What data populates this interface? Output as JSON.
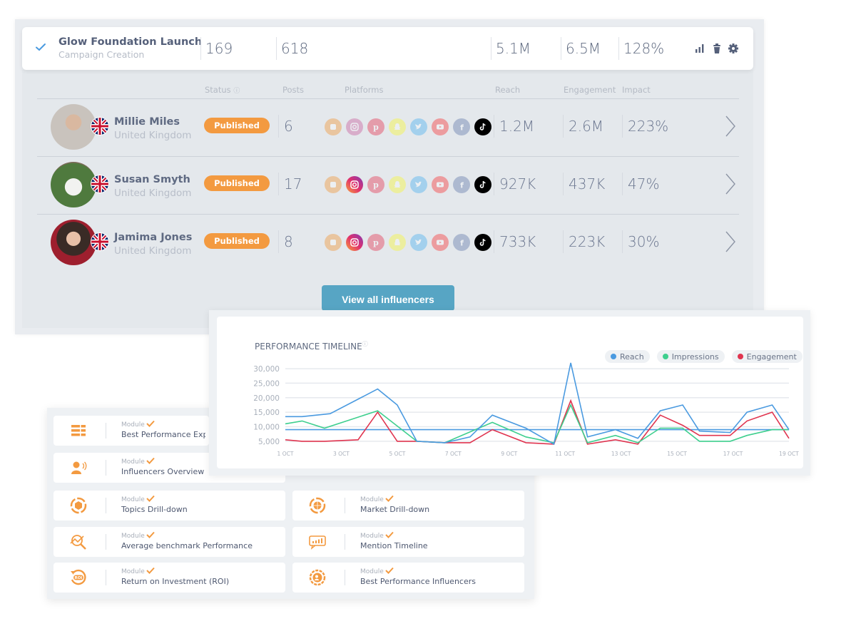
{
  "campaign": {
    "title": "Glow Foundation Launch",
    "subtitle": "Campaign Creation",
    "stats": {
      "influencers": "169",
      "posts": "618",
      "reach": "5.1M",
      "engagement": "6.5M",
      "impact": "128%"
    },
    "actions": [
      "bar-chart-icon",
      "trash-icon",
      "gear-icon"
    ]
  },
  "table": {
    "columns": {
      "status": "Status",
      "posts": "Posts",
      "platforms": "Platforms",
      "reach": "Reach",
      "engagement": "Engagement",
      "impact": "Impact"
    },
    "platforms": [
      "blogger",
      "instagram",
      "pinterest",
      "snapchat",
      "twitter",
      "youtube",
      "facebook",
      "tiktok"
    ],
    "rows": [
      {
        "name": "Millie Miles",
        "country": "United Kingdom",
        "status": "Published",
        "posts": "6",
        "reach": "1.2M",
        "engagement": "2.6M",
        "impact": "223%",
        "active_platforms": [
          "tiktok"
        ]
      },
      {
        "name": "Susan Smyth",
        "country": "United Kingdom",
        "status": "Published",
        "posts": "17",
        "reach": "927K",
        "engagement": "437K",
        "impact": "47%",
        "active_platforms": [
          "instagram",
          "tiktok"
        ]
      },
      {
        "name": "Jamima Jones",
        "country": "United Kingdom",
        "status": "Published",
        "posts": "8",
        "reach": "733K",
        "engagement": "223K",
        "impact": "30%",
        "active_platforms": [
          "instagram",
          "tiktok"
        ]
      }
    ],
    "view_all_label": "View all influencers"
  },
  "colors": {
    "accent_orange": "#f39a40",
    "button_blue": "#57a5c4",
    "reach": "#4a9ae0",
    "impressions": "#3ecf8e",
    "engagement": "#e0344f"
  },
  "chart_data": {
    "type": "line",
    "title": "PERFORMANCE TIMELINE",
    "xlabel": "",
    "ylabel": "",
    "ylim": [
      3000,
      31000
    ],
    "yticks": [
      5000,
      10000,
      15000,
      20000,
      25000,
      30000
    ],
    "ytick_labels": [
      "5,000",
      "10,000",
      "15,000",
      "20,000",
      "25,000",
      "30,000"
    ],
    "x": [
      1,
      2,
      3,
      4,
      5,
      6,
      7,
      8,
      9,
      10,
      11,
      12,
      13,
      14,
      15,
      16,
      17,
      18,
      19
    ],
    "xtick_labels": [
      "1 OCT",
      "3 OCT",
      "5 OCT",
      "7 OCT",
      "9 OCT",
      "11 OCT",
      "13 OCT",
      "15 OCT",
      "17 OCT",
      "19 OCT"
    ],
    "xtick_positions": [
      1,
      3,
      5,
      7,
      9,
      11,
      13,
      15,
      17,
      19
    ],
    "reference_line": 9000,
    "legend_position": "top-right",
    "grid": true,
    "series": [
      {
        "name": "Reach",
        "color": "#4a9ae0",
        "x": [
          1,
          1.6,
          2.6,
          4.3,
          5,
          5.7,
          6.7,
          7.6,
          8.4,
          9.6,
          10.6,
          11.2,
          11.8,
          12.8,
          13.6,
          14.4,
          15.2,
          15.8,
          16.9,
          17.5,
          18.4,
          19
        ],
        "values": [
          13500,
          13500,
          14500,
          23000,
          17500,
          5000,
          4500,
          6500,
          14000,
          9500,
          4000,
          32000,
          6500,
          9000,
          6000,
          15500,
          17500,
          8500,
          8000,
          15000,
          17500,
          9000
        ]
      },
      {
        "name": "Impressions",
        "color": "#3ecf8e",
        "x": [
          1,
          1.6,
          2.4,
          4.3,
          5.7,
          6.7,
          8.4,
          9.6,
          10.6,
          11.2,
          11.8,
          12.8,
          13.6,
          14.4,
          15.2,
          15.8,
          16.9,
          17.5,
          18.4,
          19
        ],
        "values": [
          11000,
          12000,
          9500,
          15500,
          5000,
          4500,
          11500,
          6500,
          4500,
          17500,
          4500,
          7000,
          4500,
          9500,
          9500,
          5000,
          5000,
          7000,
          9000,
          9000
        ]
      },
      {
        "name": "Engagement",
        "color": "#e0344f",
        "x": [
          1,
          1.6,
          2.4,
          3.6,
          4.3,
          5,
          5.7,
          6.7,
          7.6,
          8.4,
          9.6,
          10.6,
          11.2,
          11.8,
          12.8,
          13.6,
          14.4,
          15.2,
          15.8,
          16.9,
          17.5,
          18.4,
          19
        ],
        "values": [
          5500,
          5000,
          5000,
          5500,
          15000,
          5000,
          5000,
          4500,
          4500,
          9000,
          4500,
          4000,
          19000,
          4000,
          5500,
          4000,
          14000,
          10500,
          7000,
          7000,
          12000,
          15000,
          6000
        ]
      }
    ]
  },
  "modules": {
    "kicker": "Module",
    "items": [
      {
        "name": "Best Performance Exposure",
        "visible_text": "Best Performance Exposu",
        "icon": "list-rows-icon"
      },
      {
        "name": "Influencers Overview",
        "icon": "speaking-person-icon"
      },
      {
        "name": "Topics Drill-down",
        "icon": "cube-cycle-icon"
      },
      {
        "name": "Market Drill-down",
        "icon": "globe-cycle-icon"
      },
      {
        "name": "Average benchmark Performance",
        "icon": "magnifier-chart-icon"
      },
      {
        "name": "Mention Timeline",
        "icon": "chat-bars-icon"
      },
      {
        "name": "Return on Investment (ROI)",
        "icon": "roi-icon"
      },
      {
        "name": "Best Performance Influencers",
        "icon": "badge-person-icon"
      }
    ]
  }
}
